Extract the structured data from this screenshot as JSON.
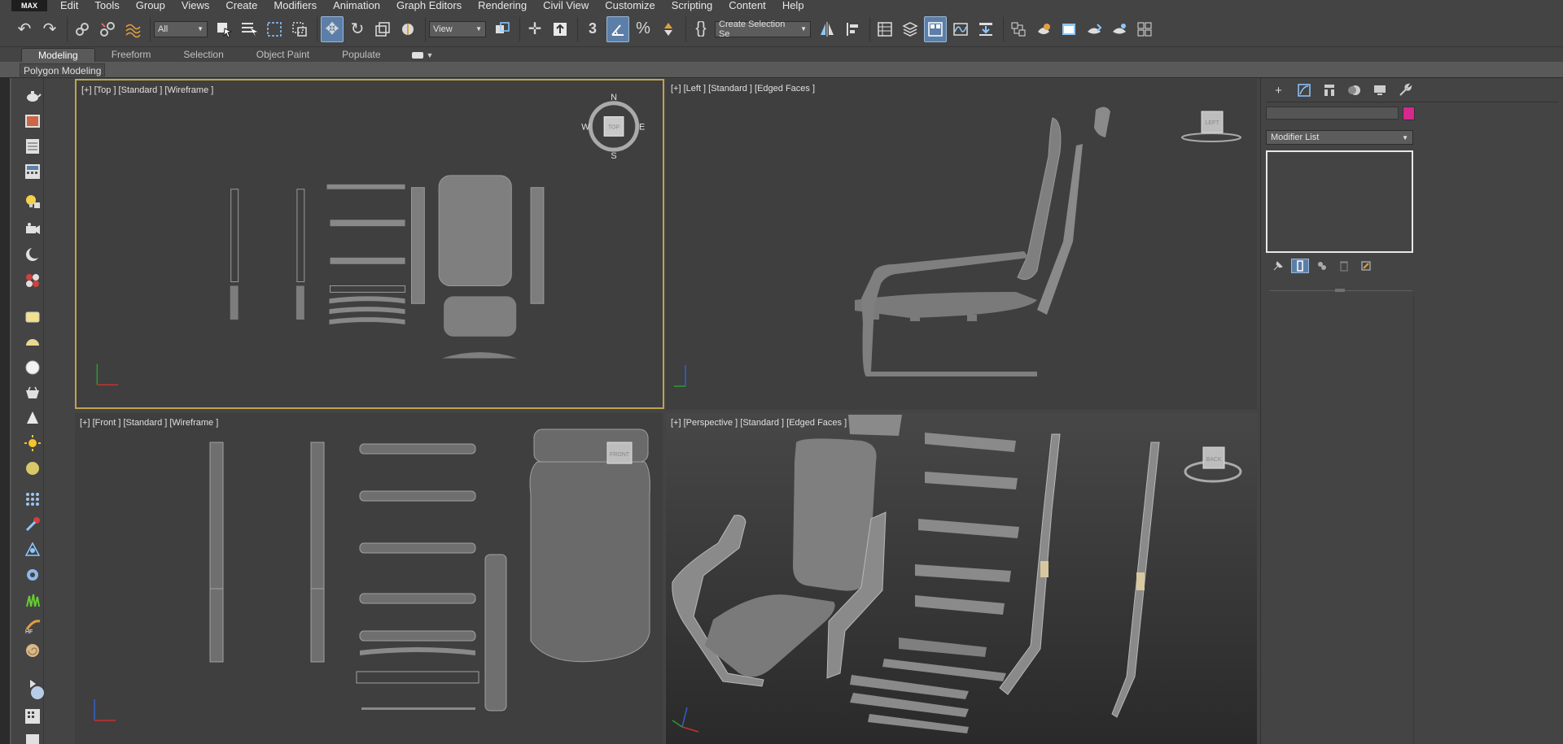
{
  "menu": {
    "logo": "MAX",
    "items": [
      "Edit",
      "Tools",
      "Group",
      "Views",
      "Create",
      "Modifiers",
      "Animation",
      "Graph Editors",
      "Rendering",
      "Civil View",
      "Customize",
      "Scripting",
      "Content",
      "Help"
    ]
  },
  "toolbar": {
    "filter_value": "All",
    "ref_coord_value": "View",
    "selection_set_value": "Create Selection Se",
    "snap_value": "3",
    "icons": [
      "undo-icon",
      "redo-icon",
      "link-icon",
      "unlink-icon",
      "bind-space-warp-icon",
      "select-object-icon",
      "select-by-name-icon",
      "rectangular-region-icon",
      "window-crossing-icon",
      "select-move-icon",
      "select-rotate-icon",
      "select-scale-icon",
      "select-manipulate-icon",
      "snap-toggle-icon",
      "angle-snap-icon",
      "percent-snap-icon",
      "spinner-snap-icon",
      "edit-named-selections-icon",
      "mirror-icon",
      "align-icon",
      "scene-explorer-icon",
      "layer-explorer-icon",
      "ribbon-toggle-icon",
      "curve-editor-icon",
      "schematic-view-icon",
      "material-editor-icon",
      "render-setup-icon",
      "rendered-frame-window-icon",
      "render-production-icon",
      "render-iterative-icon",
      "render-cloud-icon"
    ]
  },
  "ribbon": {
    "tabs": [
      "Modeling",
      "Freeform",
      "Selection",
      "Object Paint",
      "Populate"
    ],
    "active_tab": "Modeling",
    "panel_label": "Polygon Modeling"
  },
  "viewports": {
    "top": {
      "label": "[+] [Top ] [Standard ] [Wireframe ]",
      "cube": "TOP",
      "compass": [
        "N",
        "E",
        "S",
        "W"
      ]
    },
    "left": {
      "label": "[+] [Left ] [Standard ] [Edged Faces ]",
      "cube": "LEFT"
    },
    "front": {
      "label": "[+] [Front ] [Standard ] [Wireframe ]",
      "cube": "FRONT"
    },
    "perspective": {
      "label": "[+] [Perspective ] [Standard ] [Edged Faces ]",
      "cube": "BACK"
    }
  },
  "command_panel": {
    "tabs": [
      "create-tab",
      "modify-tab",
      "hierarchy-tab",
      "motion-tab",
      "display-tab",
      "utilities-tab"
    ],
    "active_tab": "modify-tab",
    "object_color": "#d6288e",
    "modifier_list_label": "Modifier List"
  },
  "colors": {
    "ui_bg": "#444444",
    "viewport_bg": "#3f3f3f",
    "active_viewport_border": "#bfa352",
    "active_button": "#5b7fa8"
  }
}
